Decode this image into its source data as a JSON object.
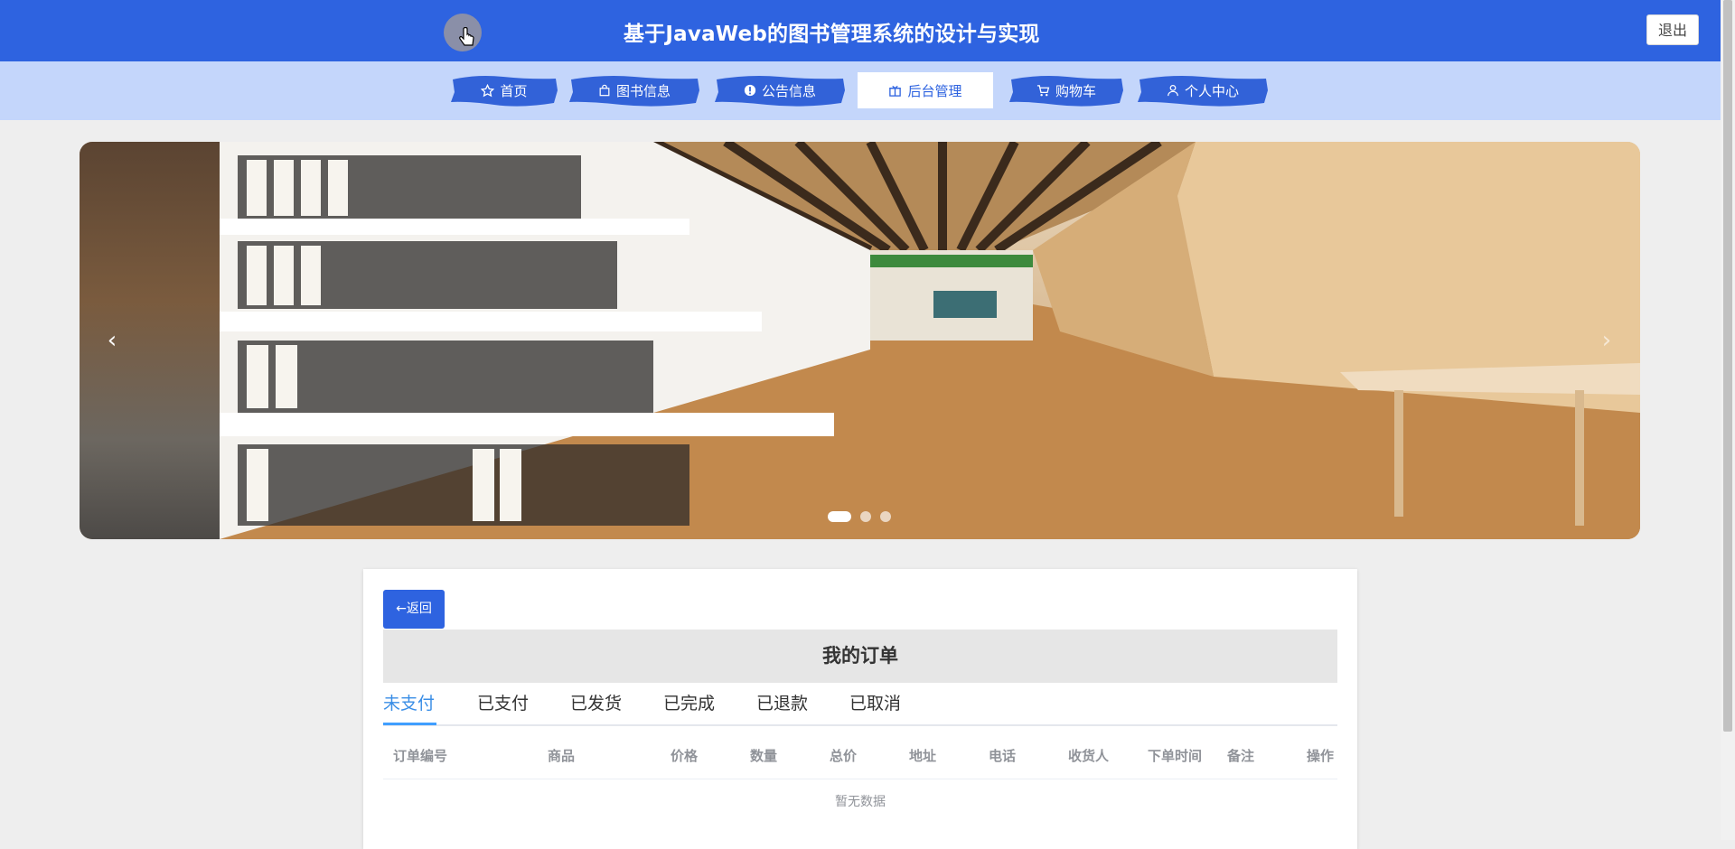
{
  "header": {
    "title": "基于JavaWeb的图书管理系统的设计与实现",
    "username": "​",
    "logout_label": "退出"
  },
  "nav": {
    "items": [
      {
        "label": "首页",
        "icon": "star-icon"
      },
      {
        "label": "图书信息",
        "icon": "bag-icon"
      },
      {
        "label": "公告信息",
        "icon": "info-icon"
      },
      {
        "label": "后台管理",
        "icon": "box-icon"
      },
      {
        "label": "购物车",
        "icon": "cart-icon"
      },
      {
        "label": "个人中心",
        "icon": "user-icon"
      }
    ],
    "active_index": 3
  },
  "carousel": {
    "prev": "‹",
    "next": "›",
    "slide_count": 3,
    "active_slide": 0
  },
  "orders": {
    "back_label": "←返回",
    "title": "我的订单",
    "tabs": [
      "未支付",
      "已支付",
      "已发货",
      "已完成",
      "已退款",
      "已取消"
    ],
    "active_tab": 0,
    "columns": [
      "订单编号",
      "商品",
      "价格",
      "数量",
      "总价",
      "地址",
      "电话",
      "收货人",
      "下单时间",
      "备注",
      "操作"
    ],
    "rows": [],
    "empty_text": "暂无数据"
  },
  "colors": {
    "primary": "#2e63e0",
    "nav_bg": "#c4d6fb",
    "tab_active": "#409eff"
  }
}
